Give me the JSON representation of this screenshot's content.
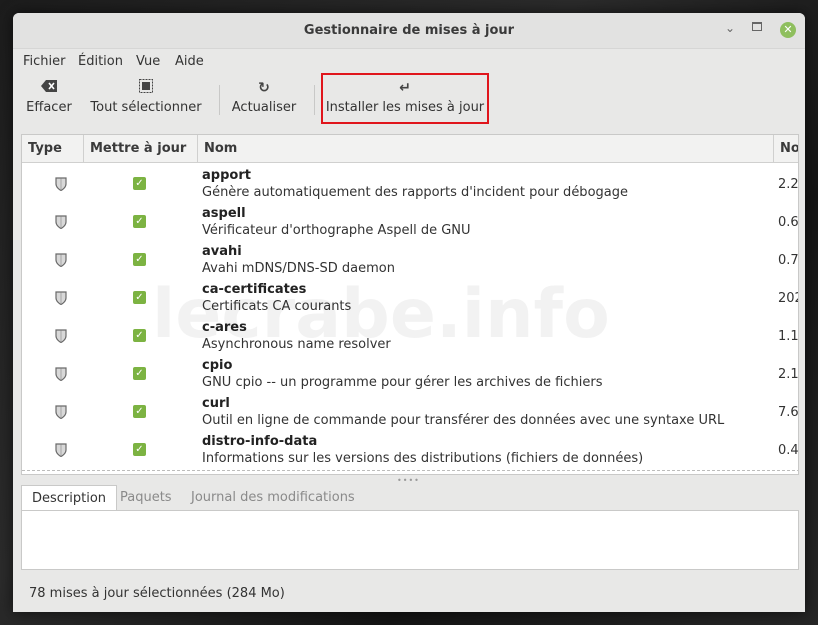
{
  "window": {
    "title": "Gestionnaire de mises à jour"
  },
  "menubar": {
    "items": [
      "Fichier",
      "Édition",
      "Vue",
      "Aide"
    ]
  },
  "toolbar": {
    "clear_label": "Effacer",
    "select_all_label": "Tout sélectionner",
    "refresh_label": "Actualiser",
    "install_label": "Installer les mises à jour",
    "highlight_color": "#e0151c"
  },
  "table": {
    "columns": [
      "Type",
      "Mettre à jour",
      "Nom",
      "No"
    ],
    "rows": [
      {
        "name": "apport",
        "description": "Génère automatiquement des rapports d'incident pour débogage",
        "version": "2.2"
      },
      {
        "name": "aspell",
        "description": "Vérificateur d'orthographe Aspell de GNU",
        "version": "0.6"
      },
      {
        "name": "avahi",
        "description": "Avahi mDNS/DNS-SD daemon",
        "version": "0.7"
      },
      {
        "name": "ca-certificates",
        "description": "Certificats CA courants",
        "version": "202"
      },
      {
        "name": "c-ares",
        "description": "Asynchronous name resolver",
        "version": "1.1"
      },
      {
        "name": "cpio",
        "description": "GNU cpio -- un programme pour gérer les archives de fichiers",
        "version": "2.1"
      },
      {
        "name": "curl",
        "description": "Outil en ligne de commande pour transférer des données avec une syntaxe URL",
        "version": "7.6"
      },
      {
        "name": "distro-info-data",
        "description": "Informations sur les versions des distributions (fichiers de données)",
        "version": "0.4"
      }
    ]
  },
  "tabs": [
    "Description",
    "Paquets",
    "Journal des modifications"
  ],
  "status": {
    "text": "78 mises à jour sélectionnées (284 Mo)"
  },
  "watermark": "lecrabe.info",
  "colors": {
    "check_green": "#7cb342",
    "close_green": "#8fbf5e"
  }
}
